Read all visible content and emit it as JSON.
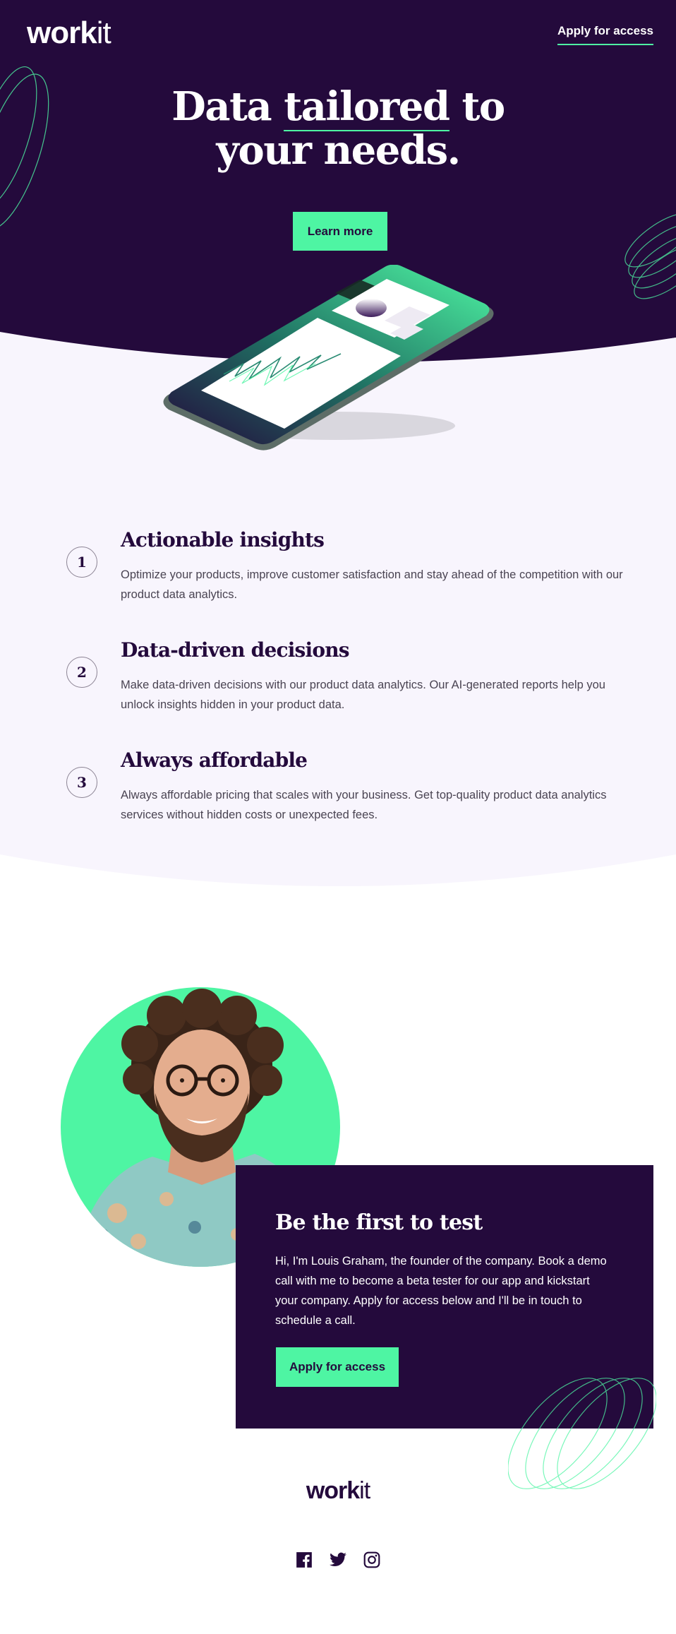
{
  "header": {
    "logo_main": "work",
    "logo_thin": "it",
    "nav_apply": "Apply for access"
  },
  "hero": {
    "title_line1_a": "Data ",
    "title_line1_b": "tailored",
    "title_line1_c": " to",
    "title_line2": "your needs.",
    "cta": "Learn more"
  },
  "features": [
    {
      "number": "1",
      "title": "Actionable insights",
      "text": "Optimize your products, improve customer satisfaction and stay ahead of the competition with our product data analytics."
    },
    {
      "number": "2",
      "title": "Data-driven decisions",
      "text": "Make data-driven decisions with our product data analytics. Our AI-generated reports help you unlock insights hidden in your product data."
    },
    {
      "number": "3",
      "title": "Always affordable",
      "text": "Always affordable pricing that scales with your business. Get top-quality product data analytics services without hidden costs or unexpected fees."
    }
  ],
  "founder": {
    "title": "Be the first to test",
    "text": "Hi, I'm Louis Graham, the founder of the company. Book a demo call with me to become a beta tester for our app and kickstart your company. Apply for access below and I'll be in touch to schedule a call.",
    "cta": "Apply for access"
  },
  "footer": {
    "logo_main": "work",
    "logo_thin": "it",
    "socials": [
      "facebook-icon",
      "twitter-icon",
      "instagram-icon"
    ]
  },
  "colors": {
    "brand_dark": "#240a3c",
    "accent_green": "#4ef5a3",
    "light_bg": "#f8f5fd",
    "text_gray": "#4a4452"
  }
}
